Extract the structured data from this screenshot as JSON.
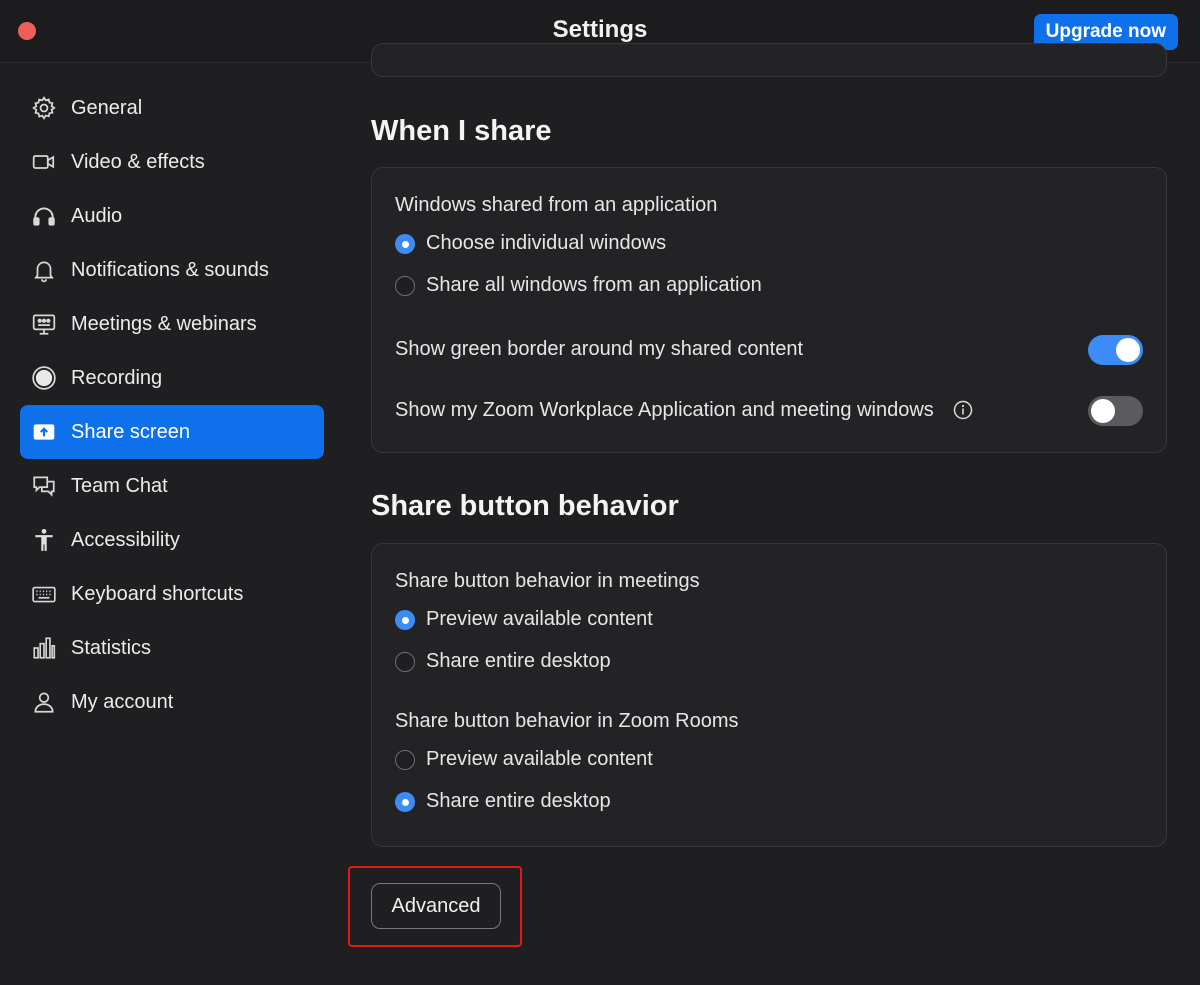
{
  "window": {
    "title": "Settings",
    "upgrade_label": "Upgrade now"
  },
  "sidebar": {
    "items": [
      {
        "label": "General",
        "icon": "gear-icon"
      },
      {
        "label": "Video & effects",
        "icon": "video-icon"
      },
      {
        "label": "Audio",
        "icon": "headphones-icon"
      },
      {
        "label": "Notifications & sounds",
        "icon": "bell-icon"
      },
      {
        "label": "Meetings & webinars",
        "icon": "meetings-icon"
      },
      {
        "label": "Recording",
        "icon": "record-icon"
      },
      {
        "label": "Share screen",
        "icon": "share-screen-icon",
        "active": true
      },
      {
        "label": "Team Chat",
        "icon": "chat-icon"
      },
      {
        "label": "Accessibility",
        "icon": "accessibility-icon"
      },
      {
        "label": "Keyboard shortcuts",
        "icon": "keyboard-icon"
      },
      {
        "label": "Statistics",
        "icon": "statistics-icon"
      },
      {
        "label": "My account",
        "icon": "user-icon"
      }
    ]
  },
  "when_i_share": {
    "heading": "When I share",
    "windows_label": "Windows shared from an application",
    "options": [
      {
        "label": "Choose individual windows",
        "selected": true
      },
      {
        "label": "Share all windows from an application",
        "selected": false
      }
    ],
    "green_border_label": "Show green border around my shared content",
    "green_border_on": true,
    "show_windows_label": "Show my Zoom Workplace Application and meeting windows",
    "show_windows_on": false
  },
  "share_button": {
    "heading": "Share button behavior",
    "meetings_label": "Share button behavior in meetings",
    "meetings_options": [
      {
        "label": "Preview available content",
        "selected": true
      },
      {
        "label": "Share entire desktop",
        "selected": false
      }
    ],
    "rooms_label": "Share button behavior in Zoom Rooms",
    "rooms_options": [
      {
        "label": "Preview available content",
        "selected": false
      },
      {
        "label": "Share entire desktop",
        "selected": true
      }
    ]
  },
  "advanced_label": "Advanced",
  "colors": {
    "accent": "#0e71eb",
    "highlight": "#e01919",
    "background": "#1f1f22"
  }
}
